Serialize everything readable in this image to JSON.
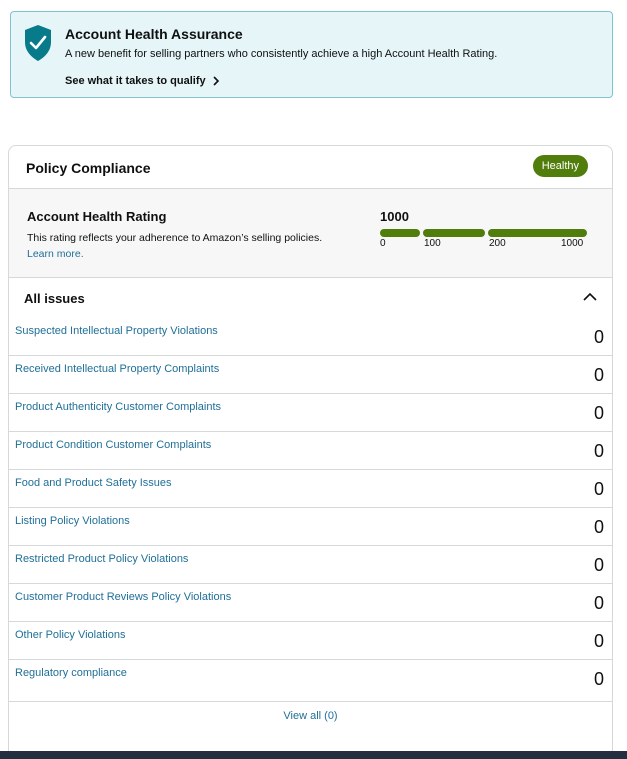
{
  "banner": {
    "title": "Account Health Assurance",
    "description": "A new benefit for selling partners who consistently achieve a high Account Health Rating.",
    "link_label": "See what it takes to qualify"
  },
  "policy": {
    "title": "Policy Compliance",
    "status": "Healthy"
  },
  "rating": {
    "title": "Account Health Rating",
    "description": "This rating reflects your adherence to Amazon’s selling policies.",
    "learn_more": "Learn more.",
    "score": "1000",
    "ticks": [
      "0",
      "100",
      "200",
      "1000"
    ]
  },
  "issues": {
    "title": "All issues",
    "items": [
      {
        "label": "Suspected Intellectual Property Violations",
        "count": "0"
      },
      {
        "label": "Received Intellectual Property Complaints",
        "count": "0"
      },
      {
        "label": "Product Authenticity Customer Complaints",
        "count": "0"
      },
      {
        "label": "Product Condition Customer Complaints",
        "count": "0"
      },
      {
        "label": "Food and Product Safety Issues",
        "count": "0"
      },
      {
        "label": "Listing Policy Violations",
        "count": "0"
      },
      {
        "label": "Restricted Product Policy Violations",
        "count": "0"
      },
      {
        "label": "Customer Product Reviews Policy Violations",
        "count": "0"
      },
      {
        "label": "Other Policy Violations",
        "count": "0"
      },
      {
        "label": "Regulatory compliance",
        "count": "0"
      }
    ],
    "view_all": "View all (0)"
  },
  "colors": {
    "accent_green": "#507d0b",
    "link_blue": "#1f6f98",
    "banner_bg": "#e6f5f8",
    "shield_teal": "#077b8a"
  }
}
